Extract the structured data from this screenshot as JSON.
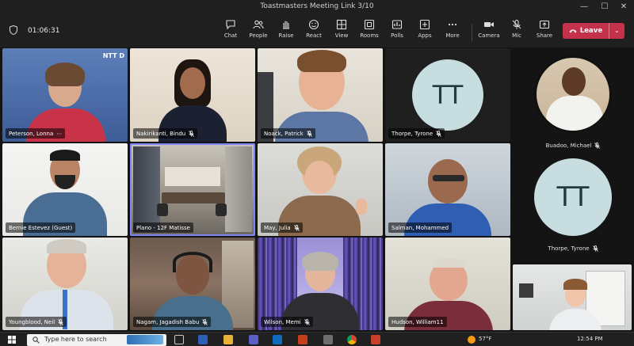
{
  "window": {
    "title": "Toastmasters Meeting Link 3/10",
    "minimize": "—",
    "maximize": "☐",
    "close": "✕"
  },
  "toolbar": {
    "timer": "01:06:31",
    "buttons": [
      "Chat",
      "People",
      "Raise",
      "React",
      "View",
      "Rooms",
      "Polls",
      "Apps",
      "More"
    ],
    "device_buttons": [
      "Camera",
      "Mic",
      "Share"
    ],
    "leave_label": "Leave",
    "leave_color": "#c4314b"
  },
  "participants": [
    {
      "name": "Peterson, Lonna",
      "extra": "⋯"
    },
    {
      "name": "Nakirikanti, Bindu"
    },
    {
      "name": "Noack, Patrick"
    },
    {
      "name": "Thorpe, Tyrone",
      "initials": "TT"
    },
    {
      "name": "Buadoo, Michael"
    },
    {
      "name": "Bernie Estevez (Guest)"
    },
    {
      "name": "Plano - 12F Matisse"
    },
    {
      "name": "May, Julia"
    },
    {
      "name": "Salman, Mohammed"
    },
    {
      "name": "Thorpe, Tyrone",
      "initials": "TT"
    },
    {
      "name": "Youngblood, Neil"
    },
    {
      "name": "Nagam, Jagadish Babu"
    },
    {
      "name": "Wilson, Memi"
    },
    {
      "name": "Hudson, William11"
    }
  ],
  "tile_watermark": "NTT D",
  "taskbar": {
    "search_placeholder": "Type here to search",
    "temperature": "57°F",
    "time": "12:54 PM"
  }
}
